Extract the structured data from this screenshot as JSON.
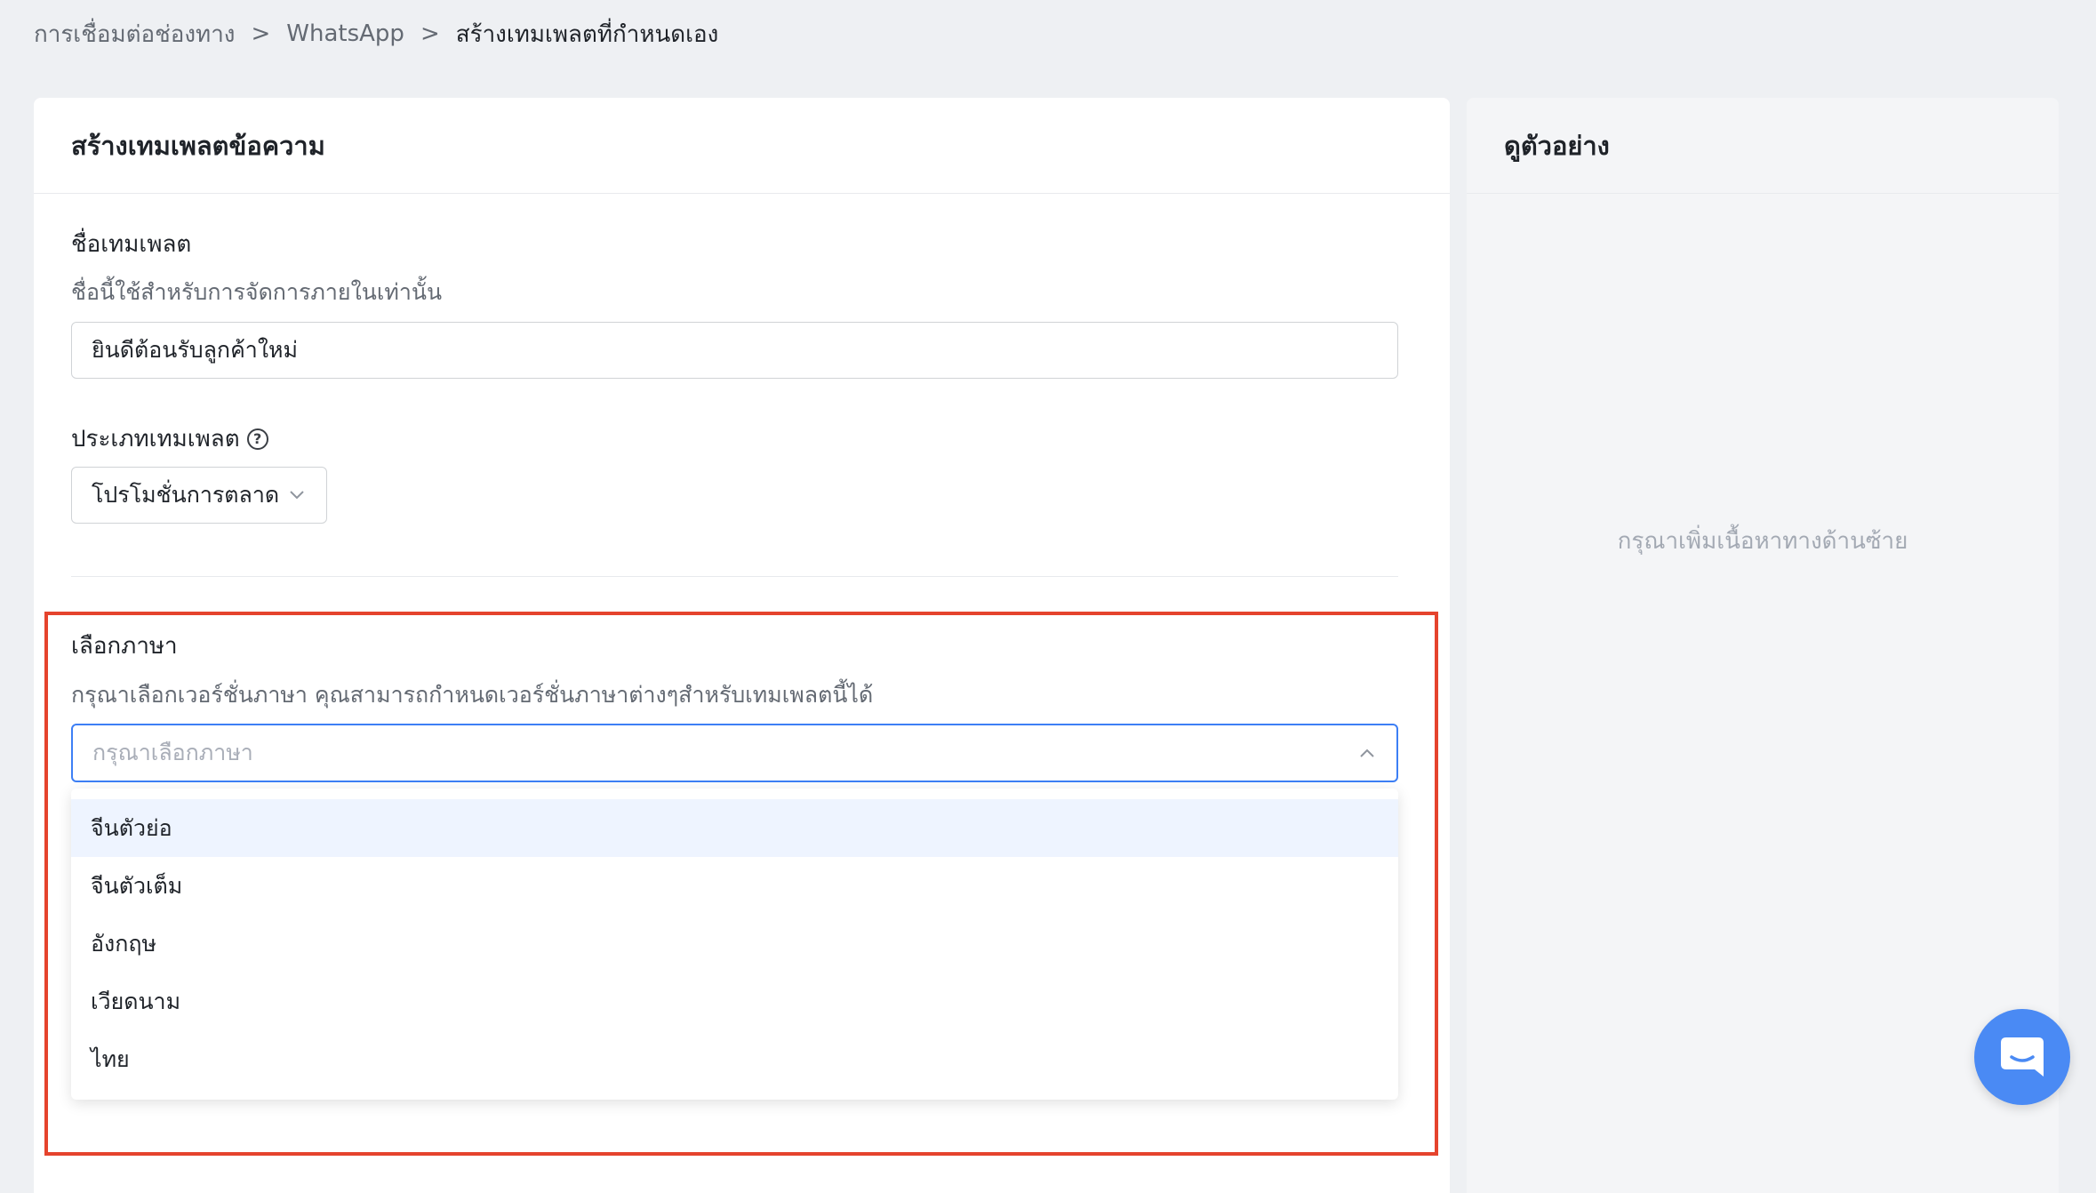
{
  "breadcrumb": {
    "items": [
      "การเชื่อมต่อช่องทาง",
      "WhatsApp",
      "สร้างเทมเพลตที่กำหนดเอง"
    ],
    "separator": ">"
  },
  "form": {
    "title": "สร้างเทมเพลตข้อความ",
    "template_name": {
      "label": "ชื่อเทมเพลต",
      "help": "ชื่อนี้ใช้สำหรับการจัดการภายในเท่านั้น",
      "value": "ยินดีต้อนรับลูกค้าใหม่"
    },
    "template_type": {
      "label": "ประเภทเทมเพลต",
      "help_icon": "?",
      "value": "โปรโมชั่นการตลาด"
    },
    "language": {
      "label": "เลือกภาษา",
      "help": "กรุณาเลือกเวอร์ชั่นภาษา คุณสามารถกำหนดเวอร์ชั่นภาษาต่างๆสำหรับเทมเพลตนี้ได้",
      "placeholder": "กรุณาเลือกภาษา",
      "options": [
        "จีนตัวย่อ",
        "จีนตัวเต็ม",
        "อังกฤษ",
        "เวียดนาม",
        "ไทย"
      ],
      "hovered_option": "จีนตัวย่อ"
    }
  },
  "preview": {
    "title": "ดูตัวอย่าง",
    "empty_text": "กรุณาเพิ่มเนื้อหาทางด้านซ้าย"
  },
  "icons": {
    "type_help": "question-circle-icon",
    "select_chevron": "chevron-down-icon",
    "language_chevron": "chevron-up-icon",
    "chat": "chat-bubble-icon"
  },
  "colors": {
    "accent": "#3d7ff5",
    "highlight": "#e5432d",
    "chat_fab": "#4a8af4",
    "hover_bg": "#eef4ff"
  }
}
